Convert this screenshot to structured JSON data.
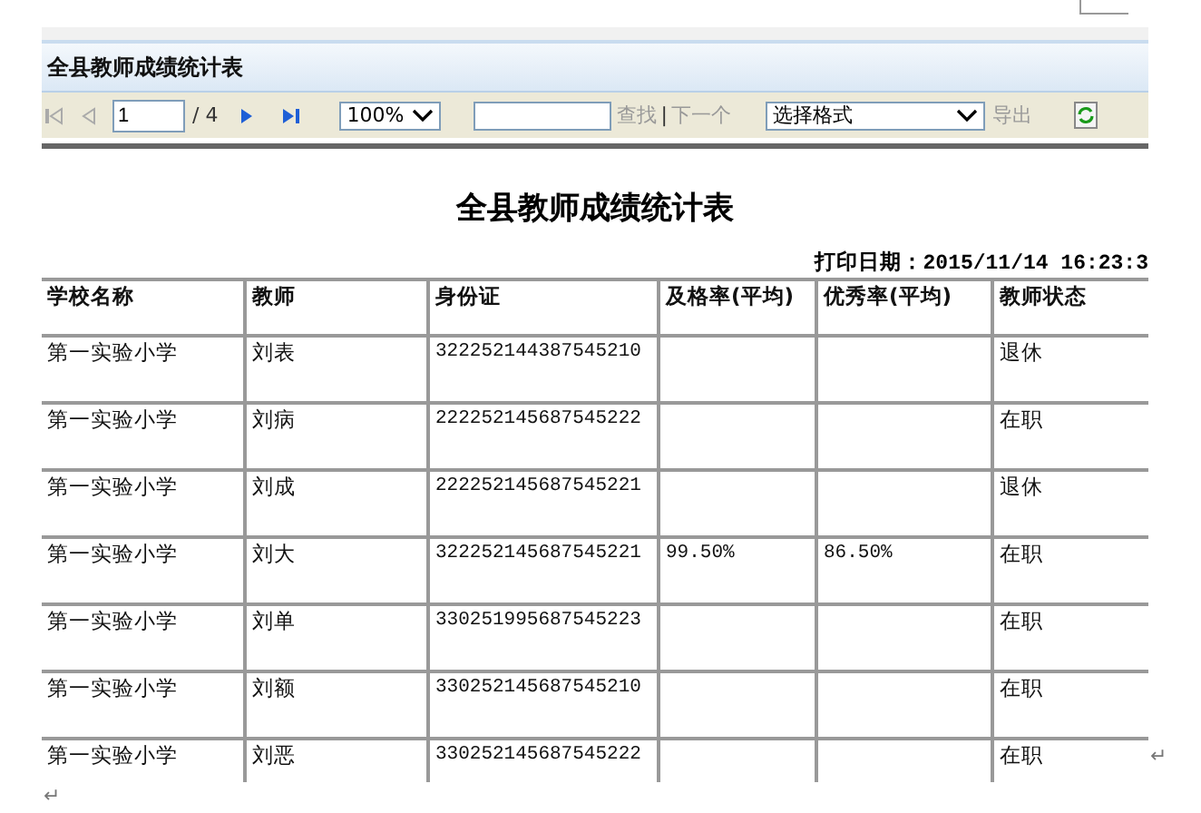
{
  "viewer": {
    "title": "全县教师成绩统计表",
    "nav_buttons": [
      {
        "kind": "first",
        "disabled": true
      },
      {
        "kind": "prev",
        "disabled": true
      },
      {
        "kind": "next",
        "disabled": false
      },
      {
        "kind": "last",
        "disabled": false
      }
    ],
    "page": "1",
    "page_total": "/ 4",
    "zoom": "100%",
    "find_label": "查找",
    "separator": "|",
    "next_label": "下一个",
    "format": "选择格式",
    "export_label": "导出"
  },
  "report": {
    "title": "全县教师成绩统计表",
    "print_date": "打印日期：2015/11/14 16:23:3",
    "columns": [
      "学校名称",
      "教师",
      "身份证",
      "及格率(平均)",
      "优秀率(平均)",
      "教师状态"
    ],
    "rows": [
      [
        "第一实验小学",
        "刘表",
        "322252144387545210",
        "",
        "",
        "退休"
      ],
      [
        "第一实验小学",
        "刘病",
        "222252145687545222",
        "",
        "",
        "在职"
      ],
      [
        "第一实验小学",
        "刘成",
        "222252145687545221",
        "",
        "",
        "退休"
      ],
      [
        "第一实验小学",
        "刘大",
        "322252145687545221",
        "99.50%",
        "86.50%",
        "在职"
      ],
      [
        "第一实验小学",
        "刘单",
        "330251995687545223",
        "",
        "",
        "在职"
      ],
      [
        "第一实验小学",
        "刘额",
        "330252145687545210",
        "",
        "",
        "在职"
      ],
      [
        "第一实验小学",
        "刘恶",
        "330252145687545222",
        "",
        "",
        "在职"
      ]
    ]
  },
  "paragraph_marks": [
    "↵",
    "↵"
  ]
}
